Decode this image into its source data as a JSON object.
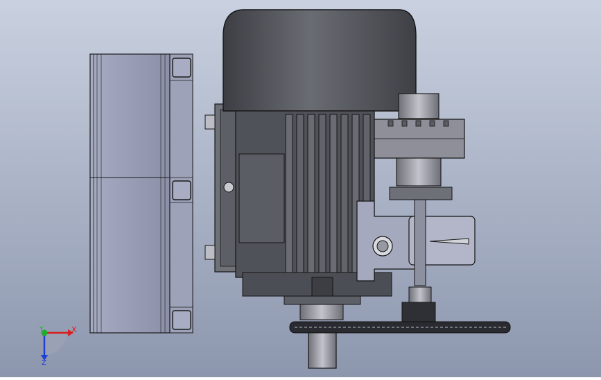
{
  "viewport": {
    "background_top": "#c9d1e0",
    "background_bottom": "#8a94ab"
  },
  "colors": {
    "motor_dark": "#4a4c52",
    "motor_mid": "#6b6d74",
    "plate": "#9a9fb3",
    "edge": "#1a1a1a",
    "axis_x": "#d61f1f",
    "axis_y": "#1fae2a",
    "axis_z": "#1f3fd6"
  },
  "triad": {
    "x_label": "X",
    "y_label": "Y",
    "z_label": "Z"
  },
  "parts": {
    "left_guard": "guard",
    "motor": "motor",
    "coupling": "coupling",
    "sprocket": "sprocket",
    "shaft": "shaft"
  }
}
